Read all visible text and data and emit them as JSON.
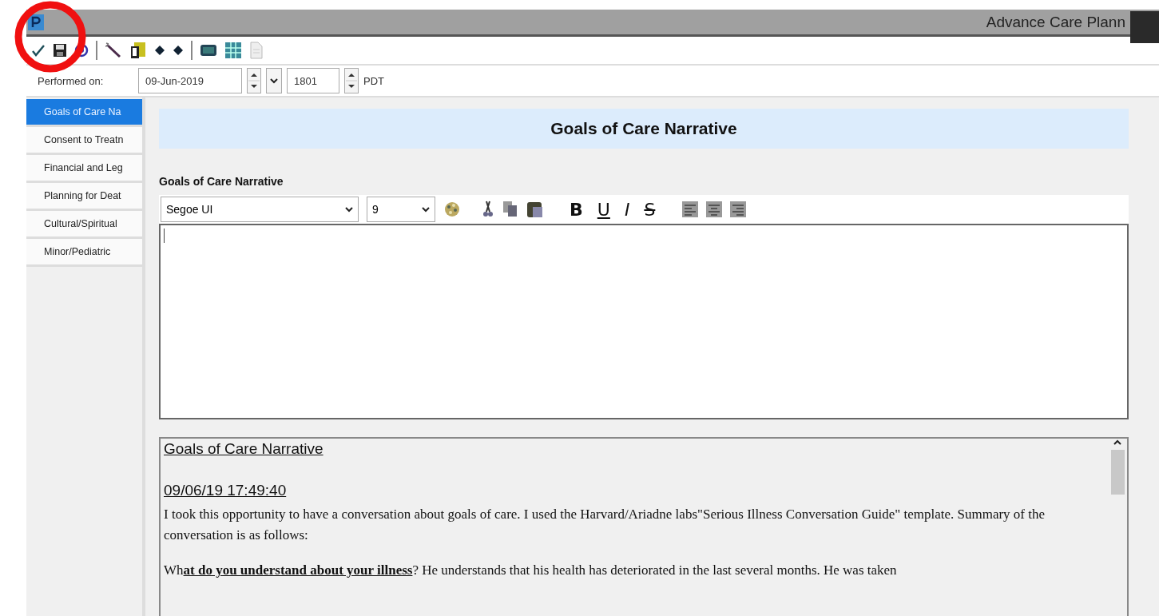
{
  "window": {
    "title": "Advance Care Plann"
  },
  "performed": {
    "label": "Performed on:",
    "date": "09-Jun-2019",
    "time": "1801",
    "timezone": "PDT"
  },
  "sections": [
    {
      "label": "Goals of Care Na",
      "selected": true
    },
    {
      "label": "Consent to Treatn",
      "selected": false
    },
    {
      "label": "Financial and Leg",
      "selected": false
    },
    {
      "label": "Planning for Deat",
      "selected": false
    },
    {
      "label": "Cultural/Spiritual",
      "selected": false
    },
    {
      "label": "Minor/Pediatric",
      "selected": false
    }
  ],
  "form": {
    "header": "Goals of Care Narrative",
    "field_label": "Goals of Care Narrative",
    "font": "Segoe UI",
    "size": "9",
    "format_buttons": [
      {
        "kind": "bold",
        "label": "B"
      },
      {
        "kind": "underline",
        "label": "U"
      },
      {
        "kind": "italic",
        "label": "I"
      },
      {
        "kind": "strike",
        "label": "S"
      }
    ]
  },
  "note": {
    "title": "Goals of Care Narrative",
    "timestamp": "09/06/19 17:49:40",
    "paragraphs": [
      "I took this opportunity to have a conversation about goals of care. I used the Harvard/Ariadne labs\"Serious Illness Conversation Guide\" template. Summary of the conversation is as follows:",
      "Wh**at do you understand about your illness**? He understands that his health has deteriorated in the last several months. He was taken"
    ]
  }
}
